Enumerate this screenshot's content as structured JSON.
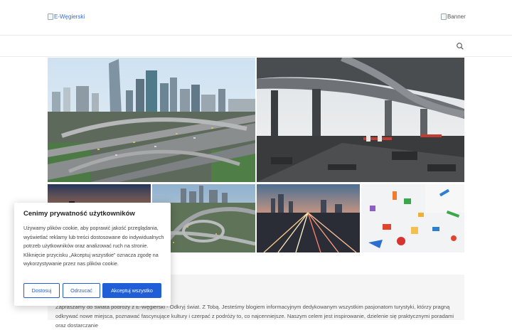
{
  "header": {
    "logo_alt": "E-Węgierski",
    "banner_alt": "Banner"
  },
  "icons": {
    "search": "search-icon",
    "logo": "broken-image-icon",
    "banner": "broken-image-icon"
  },
  "gallery": {
    "images": [
      "city-highway-interchange",
      "overpass-construction",
      "sunset-city-highway",
      "aerial-highway-interchange",
      "city-light-trails",
      "crafts-on-table"
    ]
  },
  "intro": {
    "text": "Zapraszamy do świata podróży z E-Węgierski - Odkryj świat. Z Tobą. Jesteśmy blogiem informacyjnym dedykowanym wszystkim pasjonatom turystyki, którzy pragną odkrywać nowe miejsca, poznawać fascynujące kultury i czerpać z podróży to, co najcenniejsze. Naszym celem jest inspirowanie, dzielenie się praktycznymi poradami oraz dostarczanie"
  },
  "cookie": {
    "title": "Cenimy prywatność użytkowników",
    "text": "Używamy plików cookie, aby poprawić jakość przeglądania, wyświetlać reklamy lub treści dostosowane do indywidualnych potrzeb użytkowników oraz analizować ruch na stronie. Kliknięcie przycisku „Akceptuj wszystkie” oznacza zgodę na wykorzystywanie przez nas plików cookie.",
    "customize_label": "Dostosuj",
    "reject_label": "Odrzucać",
    "accept_label": "Akceptuj wszystko"
  },
  "colors": {
    "accent": "#1f5ed6",
    "link": "#3a6bd1",
    "content_bg": "#f5f5f5"
  }
}
